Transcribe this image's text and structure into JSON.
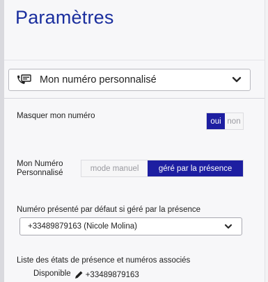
{
  "page": {
    "title": "Paramètres"
  },
  "line_selector": {
    "label": "Mon numéro personnalisé"
  },
  "mask_number": {
    "label": "Masquer mon numéro",
    "yes": "oui",
    "no": "non",
    "selected": "oui"
  },
  "custom_number": {
    "label_line1": "Mon Numéro",
    "label_line2": "Personnalisé",
    "option_manual": "mode manuel",
    "option_presence": "géré par la présence",
    "selected": "géré par la présence"
  },
  "default_number": {
    "label": "Numéro présenté par défaut si géré par la présence",
    "value": "+33489879163 (Nicole Molina)"
  },
  "presence_list": {
    "label": "Liste des états de présence et numéros associés",
    "items": [
      {
        "state": "Disponible",
        "number": "+33489879163"
      }
    ]
  },
  "colors": {
    "accent": "#1d1ea1",
    "title": "#1a2e9e"
  },
  "icons": {
    "line": "phone-card-icon",
    "dropdown": "chevron-down-icon",
    "edit": "pencil-icon"
  }
}
